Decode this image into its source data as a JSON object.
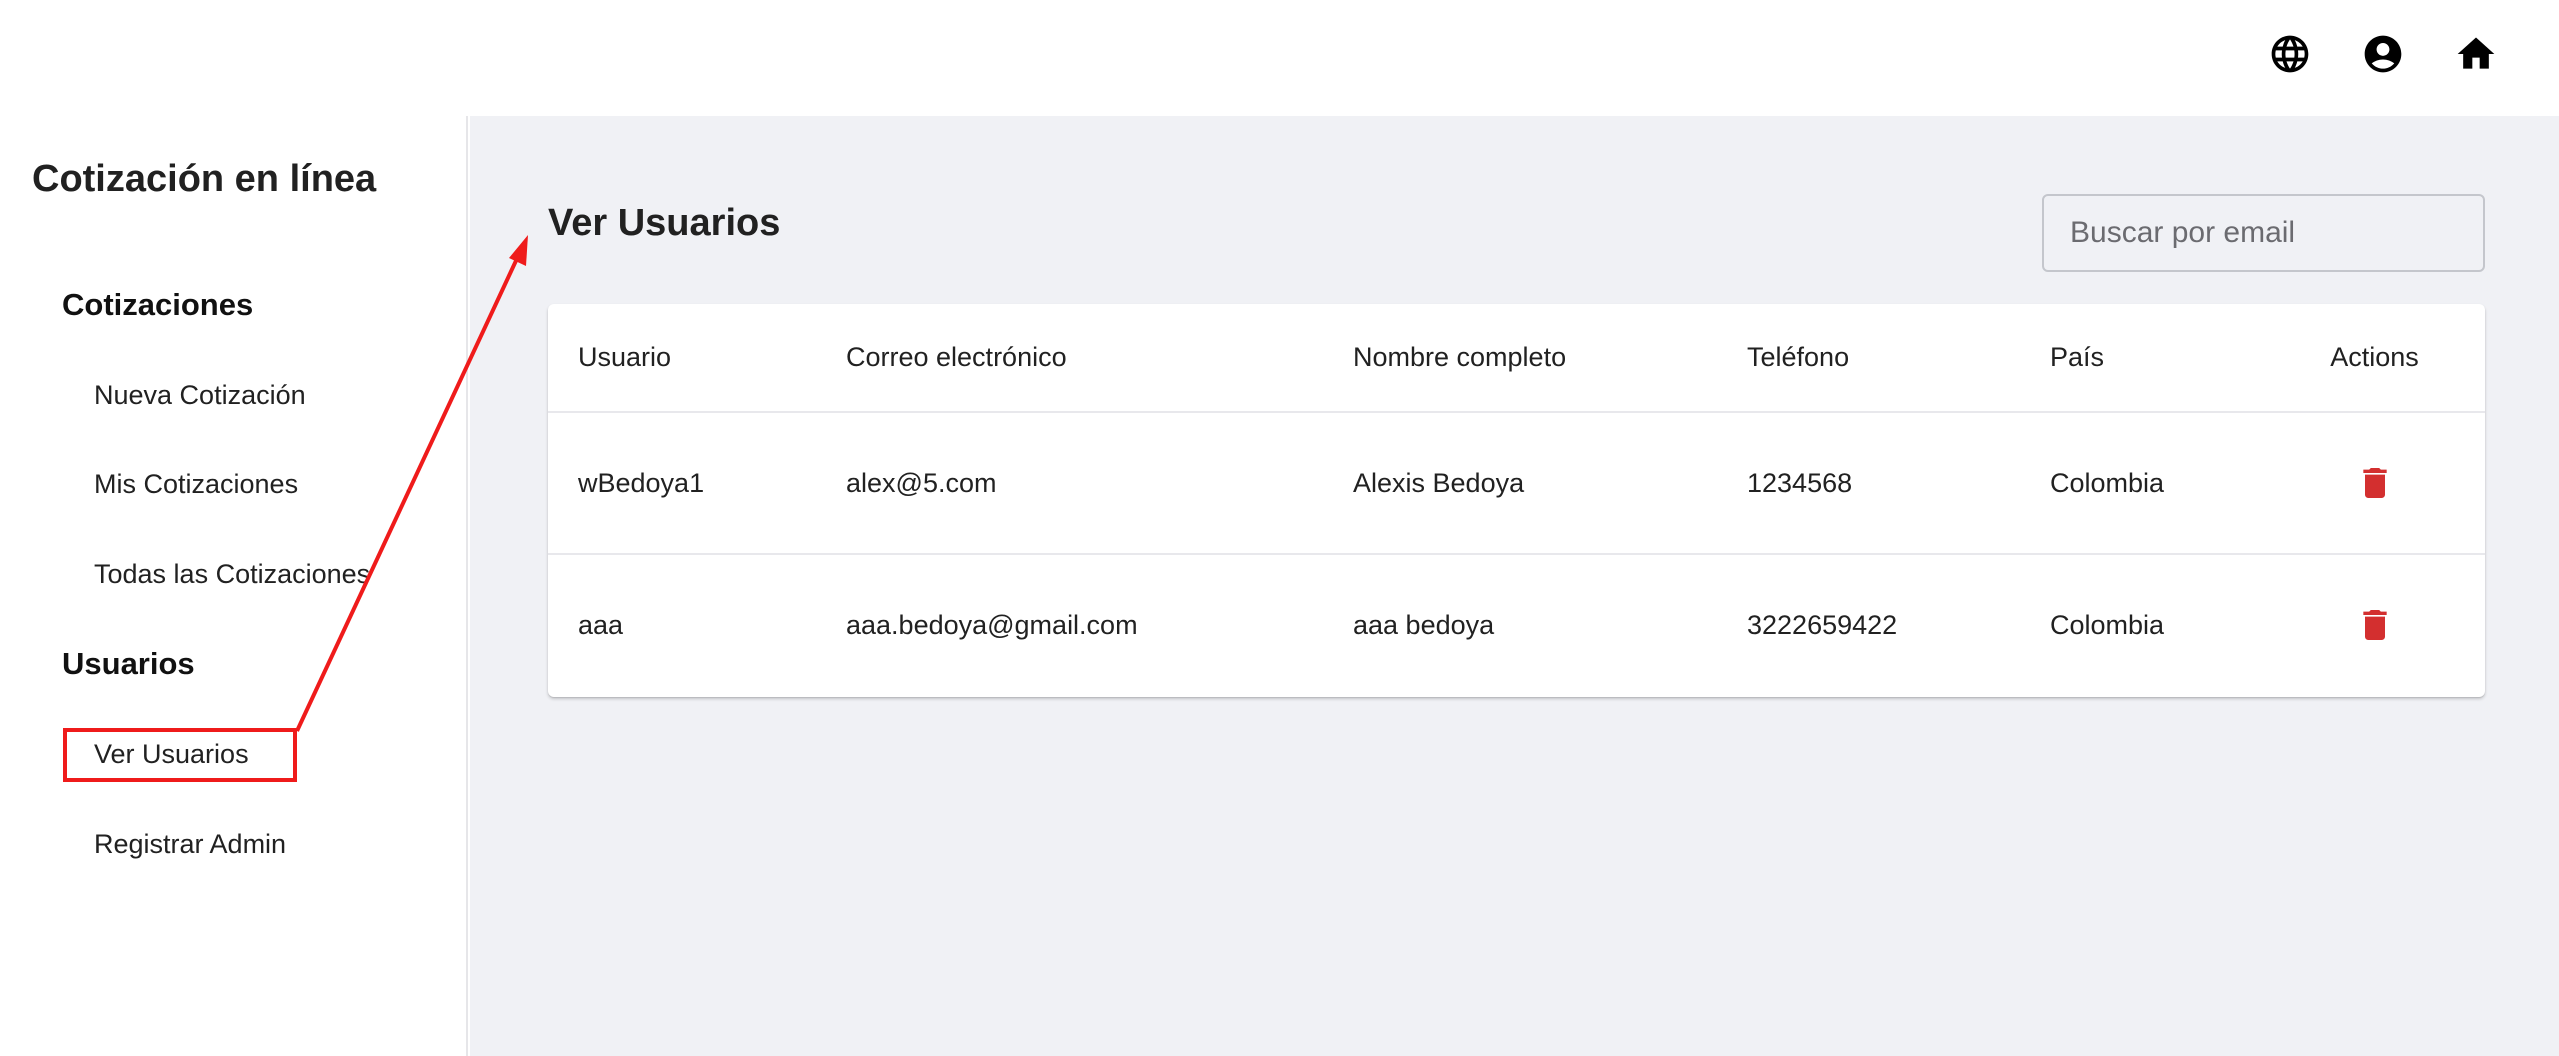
{
  "topbar": {
    "icons": [
      "globe-icon",
      "account-circle-icon",
      "home-icon"
    ]
  },
  "sidebar": {
    "app_title": "Cotización en línea",
    "sections": [
      {
        "title": "Cotizaciones",
        "items": [
          "Nueva Cotización",
          "Mis Cotizaciones",
          "Todas las Cotizaciones"
        ]
      },
      {
        "title": "Usuarios",
        "items": [
          "Ver Usuarios",
          "Registrar Admin"
        ]
      }
    ],
    "selected_item": "Ver Usuarios"
  },
  "main": {
    "page_title": "Ver Usuarios",
    "search": {
      "placeholder": "Buscar por email",
      "value": ""
    },
    "table": {
      "headers": [
        "Usuario",
        "Correo electrónico",
        "Nombre completo",
        "Teléfono",
        "País",
        "Actions"
      ],
      "rows": [
        [
          "wBedoya1",
          "alex@5.com",
          "Alexis Bedoya",
          "1234568",
          "Colombia"
        ],
        [
          "aaa",
          "aaa.bedoya@gmail.com",
          "aaa bedoya",
          "3222659422",
          "Colombia"
        ]
      ],
      "row_action_icon": "trash-icon"
    }
  },
  "colors": {
    "main_background": "#f0f1f5",
    "delete_icon": "#d32f2f",
    "annotation": "#ef1b1b"
  }
}
